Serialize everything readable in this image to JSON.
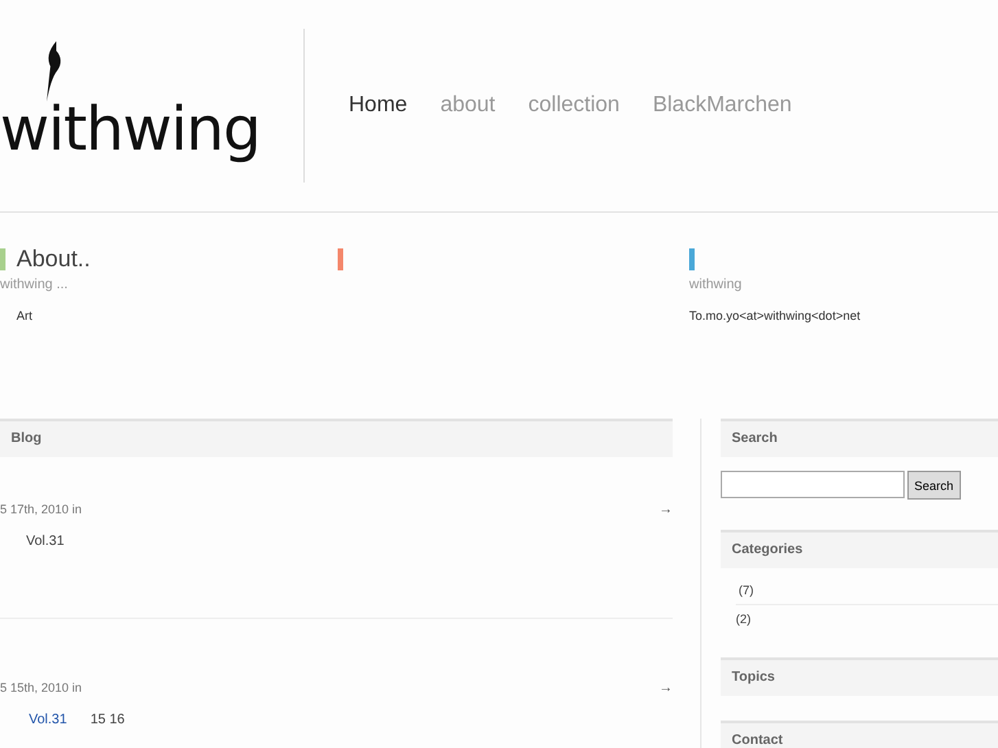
{
  "logo": {
    "text": "withwing"
  },
  "nav": [
    {
      "label": "Home",
      "selected": true
    },
    {
      "label": "about",
      "selected": false
    },
    {
      "label": "collection",
      "selected": false
    },
    {
      "label": "BlackMarchen",
      "selected": false
    }
  ],
  "features": [
    {
      "title": "About..",
      "color": "#a8d08d",
      "subtitle": "withwing ...",
      "body": "Art"
    },
    {
      "color": "#f4876b"
    },
    {
      "color": "#4aa8d8",
      "subtitle": "withwing",
      "body": "To.mo.yo<at>withwing<dot>net"
    }
  ],
  "blog": {
    "title": "Blog",
    "posts": [
      {
        "date": "5  17th, 2010 in",
        "arrow": "→",
        "kind": "text",
        "line": "Vol.31"
      },
      {
        "date": "5  15th, 2010 in",
        "arrow": "→",
        "kind": "link",
        "line": "Vol.31",
        "extra": "15  16"
      }
    ]
  },
  "sidebar": {
    "search": {
      "title": "Search",
      "button": "Search"
    },
    "categories": {
      "title": "Categories",
      "items": [
        "(7)",
        "(2)"
      ]
    },
    "topics": {
      "title": "Topics"
    },
    "contact": {
      "title": "Contact"
    }
  }
}
